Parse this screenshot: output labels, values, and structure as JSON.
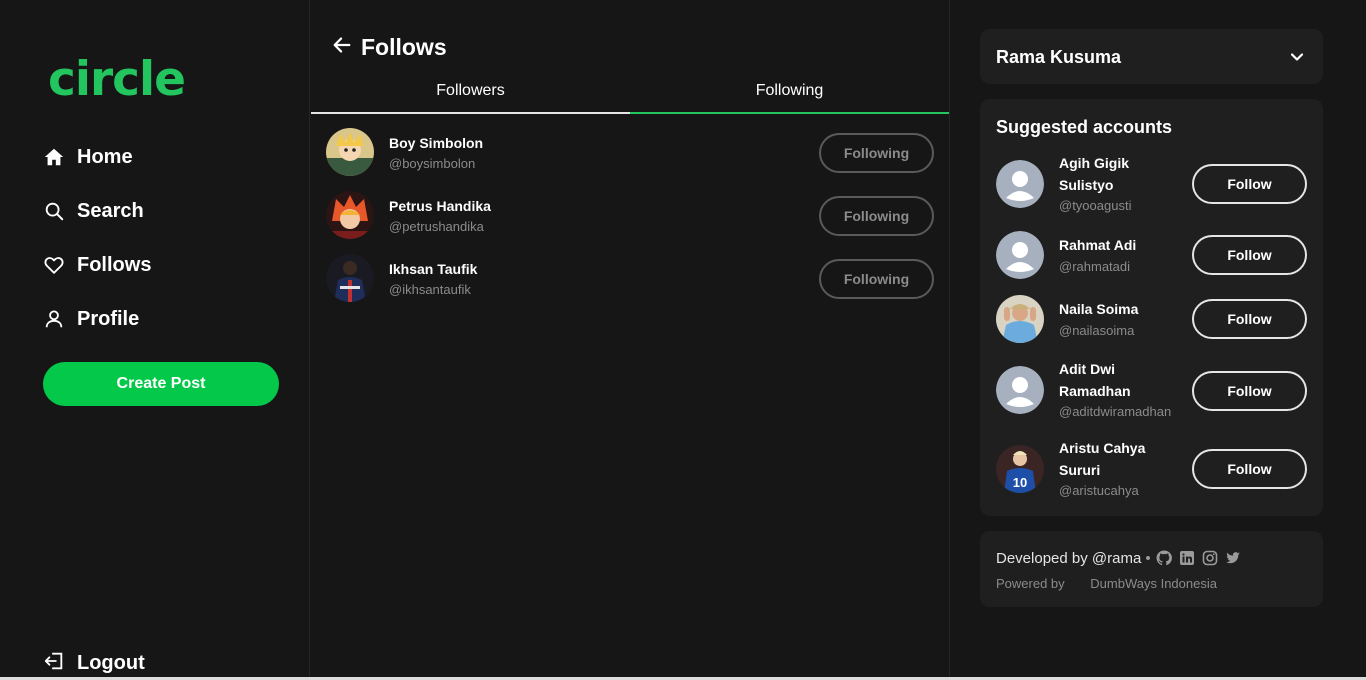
{
  "sidebar": {
    "logo": "circle",
    "nav": [
      {
        "label": "Home",
        "icon": "home-icon"
      },
      {
        "label": "Search",
        "icon": "search-icon"
      },
      {
        "label": "Follows",
        "icon": "heart-icon"
      },
      {
        "label": "Profile",
        "icon": "user-icon"
      }
    ],
    "create_post": "Create Post",
    "logout": "Logout"
  },
  "main": {
    "title": "Follows",
    "tabs": [
      {
        "label": "Followers",
        "active": false
      },
      {
        "label": "Following",
        "active": true
      }
    ],
    "rows": [
      {
        "name": "Boy Simbolon",
        "handle": "@boysimbolon",
        "button": "Following"
      },
      {
        "name": "Petrus Handika",
        "handle": "@petrushandika",
        "button": "Following"
      },
      {
        "name": "Ikhsan Taufik",
        "handle": "@ikhsantaufik",
        "button": "Following"
      }
    ]
  },
  "right": {
    "profile_name": "Rama Kusuma",
    "suggested_title": "Suggested accounts",
    "suggested": [
      {
        "name": "Agih Gigik Sulistyo",
        "handle": "@tyooagusti",
        "button": "Follow"
      },
      {
        "name": "Rahmat Adi",
        "handle": "@rahmatadi",
        "button": "Follow"
      },
      {
        "name": "Naila Soima",
        "handle": "@nailasoima",
        "button": "Follow"
      },
      {
        "name": "Adit Dwi Ramadhan",
        "handle": "@aditdwiramadhan",
        "button": "Follow"
      },
      {
        "name": "Aristu Cahya Sururi",
        "handle": "@aristucahya",
        "button": "Follow"
      }
    ],
    "footer": {
      "developed_by": "Developed by @rama",
      "separator": "•",
      "powered_label": "Powered by",
      "powered_brand": "DumbWays Indonesia",
      "social_icons": [
        "github-icon",
        "linkedin-icon",
        "instagram-icon",
        "twitter-icon"
      ]
    }
  },
  "colors": {
    "brand": "#22c55e",
    "button": "#04c84a",
    "background": "#161616",
    "card": "#1f1f1f"
  }
}
